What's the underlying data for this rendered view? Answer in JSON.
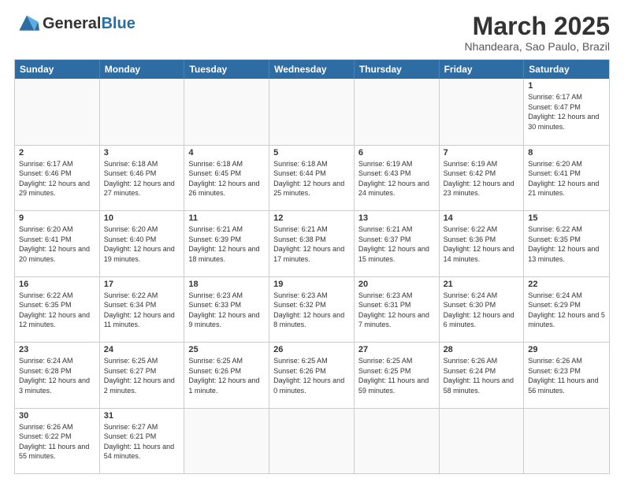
{
  "header": {
    "logo_general": "General",
    "logo_blue": "Blue",
    "month_title": "March 2025",
    "subtitle": "Nhandeara, Sao Paulo, Brazil"
  },
  "days_of_week": [
    "Sunday",
    "Monday",
    "Tuesday",
    "Wednesday",
    "Thursday",
    "Friday",
    "Saturday"
  ],
  "weeks": [
    [
      {
        "num": "",
        "info": "",
        "empty": true
      },
      {
        "num": "",
        "info": "",
        "empty": true
      },
      {
        "num": "",
        "info": "",
        "empty": true
      },
      {
        "num": "",
        "info": "",
        "empty": true
      },
      {
        "num": "",
        "info": "",
        "empty": true
      },
      {
        "num": "",
        "info": "",
        "empty": true
      },
      {
        "num": "1",
        "info": "Sunrise: 6:17 AM\nSunset: 6:47 PM\nDaylight: 12 hours\nand 30 minutes.",
        "empty": false
      }
    ],
    [
      {
        "num": "2",
        "info": "Sunrise: 6:17 AM\nSunset: 6:46 PM\nDaylight: 12 hours\nand 29 minutes.",
        "empty": false
      },
      {
        "num": "3",
        "info": "Sunrise: 6:18 AM\nSunset: 6:46 PM\nDaylight: 12 hours\nand 27 minutes.",
        "empty": false
      },
      {
        "num": "4",
        "info": "Sunrise: 6:18 AM\nSunset: 6:45 PM\nDaylight: 12 hours\nand 26 minutes.",
        "empty": false
      },
      {
        "num": "5",
        "info": "Sunrise: 6:18 AM\nSunset: 6:44 PM\nDaylight: 12 hours\nand 25 minutes.",
        "empty": false
      },
      {
        "num": "6",
        "info": "Sunrise: 6:19 AM\nSunset: 6:43 PM\nDaylight: 12 hours\nand 24 minutes.",
        "empty": false
      },
      {
        "num": "7",
        "info": "Sunrise: 6:19 AM\nSunset: 6:42 PM\nDaylight: 12 hours\nand 23 minutes.",
        "empty": false
      },
      {
        "num": "8",
        "info": "Sunrise: 6:20 AM\nSunset: 6:41 PM\nDaylight: 12 hours\nand 21 minutes.",
        "empty": false
      }
    ],
    [
      {
        "num": "9",
        "info": "Sunrise: 6:20 AM\nSunset: 6:41 PM\nDaylight: 12 hours\nand 20 minutes.",
        "empty": false
      },
      {
        "num": "10",
        "info": "Sunrise: 6:20 AM\nSunset: 6:40 PM\nDaylight: 12 hours\nand 19 minutes.",
        "empty": false
      },
      {
        "num": "11",
        "info": "Sunrise: 6:21 AM\nSunset: 6:39 PM\nDaylight: 12 hours\nand 18 minutes.",
        "empty": false
      },
      {
        "num": "12",
        "info": "Sunrise: 6:21 AM\nSunset: 6:38 PM\nDaylight: 12 hours\nand 17 minutes.",
        "empty": false
      },
      {
        "num": "13",
        "info": "Sunrise: 6:21 AM\nSunset: 6:37 PM\nDaylight: 12 hours\nand 15 minutes.",
        "empty": false
      },
      {
        "num": "14",
        "info": "Sunrise: 6:22 AM\nSunset: 6:36 PM\nDaylight: 12 hours\nand 14 minutes.",
        "empty": false
      },
      {
        "num": "15",
        "info": "Sunrise: 6:22 AM\nSunset: 6:35 PM\nDaylight: 12 hours\nand 13 minutes.",
        "empty": false
      }
    ],
    [
      {
        "num": "16",
        "info": "Sunrise: 6:22 AM\nSunset: 6:35 PM\nDaylight: 12 hours\nand 12 minutes.",
        "empty": false
      },
      {
        "num": "17",
        "info": "Sunrise: 6:22 AM\nSunset: 6:34 PM\nDaylight: 12 hours\nand 11 minutes.",
        "empty": false
      },
      {
        "num": "18",
        "info": "Sunrise: 6:23 AM\nSunset: 6:33 PM\nDaylight: 12 hours\nand 9 minutes.",
        "empty": false
      },
      {
        "num": "19",
        "info": "Sunrise: 6:23 AM\nSunset: 6:32 PM\nDaylight: 12 hours\nand 8 minutes.",
        "empty": false
      },
      {
        "num": "20",
        "info": "Sunrise: 6:23 AM\nSunset: 6:31 PM\nDaylight: 12 hours\nand 7 minutes.",
        "empty": false
      },
      {
        "num": "21",
        "info": "Sunrise: 6:24 AM\nSunset: 6:30 PM\nDaylight: 12 hours\nand 6 minutes.",
        "empty": false
      },
      {
        "num": "22",
        "info": "Sunrise: 6:24 AM\nSunset: 6:29 PM\nDaylight: 12 hours\nand 5 minutes.",
        "empty": false
      }
    ],
    [
      {
        "num": "23",
        "info": "Sunrise: 6:24 AM\nSunset: 6:28 PM\nDaylight: 12 hours\nand 3 minutes.",
        "empty": false
      },
      {
        "num": "24",
        "info": "Sunrise: 6:25 AM\nSunset: 6:27 PM\nDaylight: 12 hours\nand 2 minutes.",
        "empty": false
      },
      {
        "num": "25",
        "info": "Sunrise: 6:25 AM\nSunset: 6:26 PM\nDaylight: 12 hours\nand 1 minute.",
        "empty": false
      },
      {
        "num": "26",
        "info": "Sunrise: 6:25 AM\nSunset: 6:26 PM\nDaylight: 12 hours\nand 0 minutes.",
        "empty": false
      },
      {
        "num": "27",
        "info": "Sunrise: 6:25 AM\nSunset: 6:25 PM\nDaylight: 11 hours\nand 59 minutes.",
        "empty": false
      },
      {
        "num": "28",
        "info": "Sunrise: 6:26 AM\nSunset: 6:24 PM\nDaylight: 11 hours\nand 58 minutes.",
        "empty": false
      },
      {
        "num": "29",
        "info": "Sunrise: 6:26 AM\nSunset: 6:23 PM\nDaylight: 11 hours\nand 56 minutes.",
        "empty": false
      }
    ],
    [
      {
        "num": "30",
        "info": "Sunrise: 6:26 AM\nSunset: 6:22 PM\nDaylight: 11 hours\nand 55 minutes.",
        "empty": false
      },
      {
        "num": "31",
        "info": "Sunrise: 6:27 AM\nSunset: 6:21 PM\nDaylight: 11 hours\nand 54 minutes.",
        "empty": false
      },
      {
        "num": "",
        "info": "",
        "empty": true
      },
      {
        "num": "",
        "info": "",
        "empty": true
      },
      {
        "num": "",
        "info": "",
        "empty": true
      },
      {
        "num": "",
        "info": "",
        "empty": true
      },
      {
        "num": "",
        "info": "",
        "empty": true
      }
    ]
  ]
}
